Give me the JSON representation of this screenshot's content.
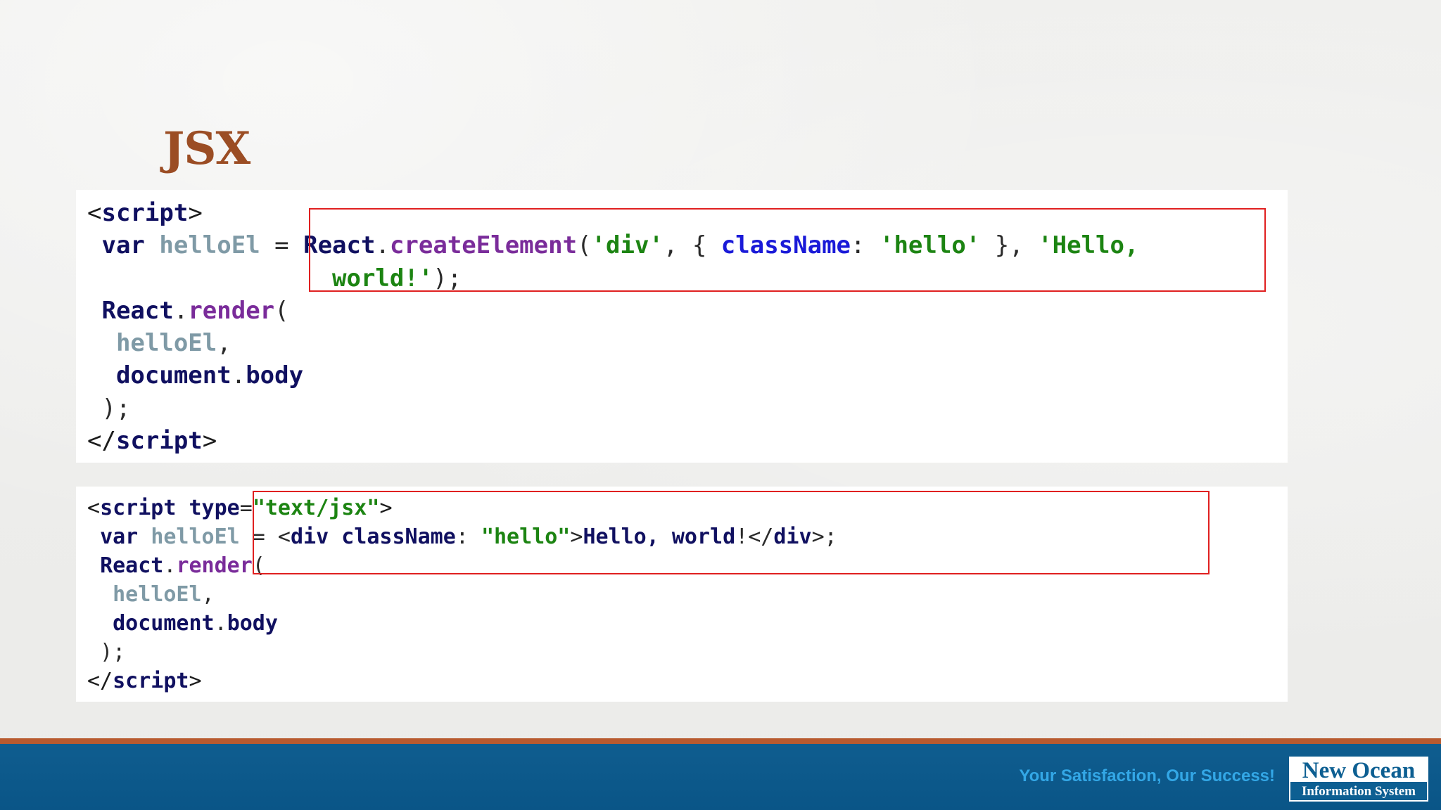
{
  "slide": {
    "title": "JSX"
  },
  "code_block_1": [
    {
      "t": "<",
      "c": "tag"
    },
    {
      "t": "script",
      "c": "kw"
    },
    {
      "t": ">",
      "c": "tag"
    },
    {
      "t": "\n"
    },
    {
      "t": " "
    },
    {
      "t": "var",
      "c": "kw"
    },
    {
      "t": " "
    },
    {
      "t": "helloEl",
      "c": "var"
    },
    {
      "t": " = ",
      "c": "punct"
    },
    {
      "t": "React",
      "c": "obj"
    },
    {
      "t": ".",
      "c": "punct"
    },
    {
      "t": "createElement",
      "c": "method"
    },
    {
      "t": "(",
      "c": "punct"
    },
    {
      "t": "'div'",
      "c": "str"
    },
    {
      "t": ", { ",
      "c": "punct"
    },
    {
      "t": "className",
      "c": "key"
    },
    {
      "t": ": ",
      "c": "punct"
    },
    {
      "t": "'hello'",
      "c": "str"
    },
    {
      "t": " }, ",
      "c": "punct"
    },
    {
      "t": "'Hello,",
      "c": "str"
    },
    {
      "t": "\n"
    },
    {
      "t": "                 "
    },
    {
      "t": "world!'",
      "c": "str"
    },
    {
      "t": ");",
      "c": "punct"
    },
    {
      "t": "\n"
    },
    {
      "t": " "
    },
    {
      "t": "React",
      "c": "obj"
    },
    {
      "t": ".",
      "c": "punct"
    },
    {
      "t": "render",
      "c": "method"
    },
    {
      "t": "(",
      "c": "punct"
    },
    {
      "t": "\n"
    },
    {
      "t": "  "
    },
    {
      "t": "helloEl",
      "c": "var"
    },
    {
      "t": ",",
      "c": "punct"
    },
    {
      "t": "\n"
    },
    {
      "t": "  "
    },
    {
      "t": "document",
      "c": "obj"
    },
    {
      "t": ".",
      "c": "punct"
    },
    {
      "t": "body",
      "c": "obj"
    },
    {
      "t": "\n"
    },
    {
      "t": " "
    },
    {
      "t": ");",
      "c": "punct"
    },
    {
      "t": "\n"
    },
    {
      "t": "</",
      "c": "tag"
    },
    {
      "t": "script",
      "c": "kw"
    },
    {
      "t": ">",
      "c": "tag"
    }
  ],
  "code_block_2": [
    {
      "t": "<",
      "c": "tag"
    },
    {
      "t": "script type",
      "c": "kw"
    },
    {
      "t": "=",
      "c": "punct"
    },
    {
      "t": "\"text/jsx\"",
      "c": "str"
    },
    {
      "t": ">",
      "c": "tag"
    },
    {
      "t": "\n"
    },
    {
      "t": " "
    },
    {
      "t": "var",
      "c": "kw"
    },
    {
      "t": " "
    },
    {
      "t": "helloEl",
      "c": "var"
    },
    {
      "t": " = <",
      "c": "punct"
    },
    {
      "t": "div className",
      "c": "text"
    },
    {
      "t": ": ",
      "c": "punct"
    },
    {
      "t": "\"hello\"",
      "c": "str"
    },
    {
      "t": ">",
      "c": "punct"
    },
    {
      "t": "Hello, world",
      "c": "text"
    },
    {
      "t": "!</",
      "c": "punct"
    },
    {
      "t": "div",
      "c": "text"
    },
    {
      "t": ">;",
      "c": "punct"
    },
    {
      "t": "\n"
    },
    {
      "t": " "
    },
    {
      "t": "React",
      "c": "obj"
    },
    {
      "t": ".",
      "c": "punct"
    },
    {
      "t": "render",
      "c": "method"
    },
    {
      "t": "(",
      "c": "punct"
    },
    {
      "t": "\n"
    },
    {
      "t": "  "
    },
    {
      "t": "helloEl",
      "c": "var"
    },
    {
      "t": ",",
      "c": "punct"
    },
    {
      "t": "\n"
    },
    {
      "t": "  "
    },
    {
      "t": "document",
      "c": "obj"
    },
    {
      "t": ".",
      "c": "punct"
    },
    {
      "t": "body",
      "c": "obj"
    },
    {
      "t": "\n"
    },
    {
      "t": " "
    },
    {
      "t": ");",
      "c": "punct"
    },
    {
      "t": "\n"
    },
    {
      "t": "</",
      "c": "tag"
    },
    {
      "t": "script",
      "c": "kw"
    },
    {
      "t": ">",
      "c": "tag"
    }
  ],
  "colors": {
    "title": "#9b4d24",
    "highlight_border": "#e02020",
    "footer_bar": "#0f5d8f",
    "footer_rule": "#b85a2f",
    "tagline": "#33a7e6"
  },
  "footer": {
    "tagline": "Your Satisfaction, Our Success!",
    "logo_name": "New Ocean",
    "logo_subtitle": "Information System"
  }
}
